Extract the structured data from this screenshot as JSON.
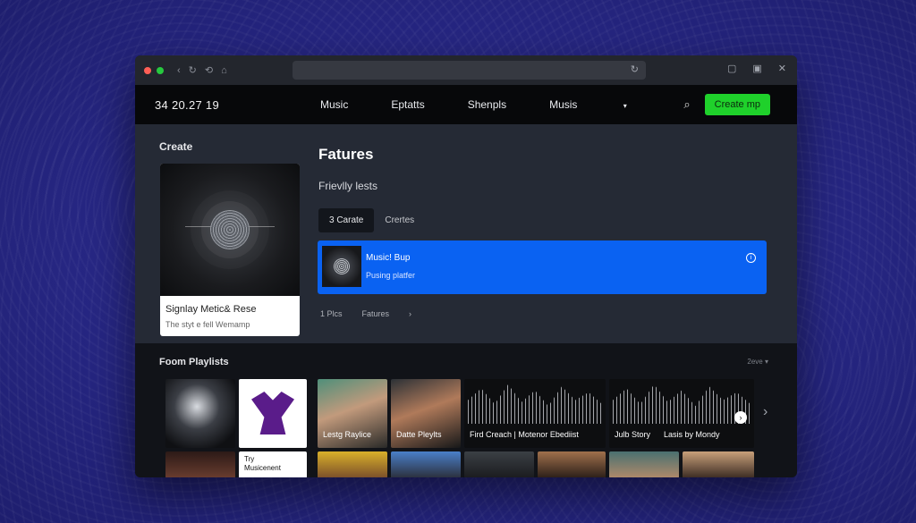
{
  "browser": {
    "icons": [
      "back-icon",
      "forward-icon",
      "history-icon",
      "share-icon",
      "reload-icon",
      "tabs-icon",
      "bookmark-icon",
      "close-icon"
    ]
  },
  "nav": {
    "brand": "34 20.27 19",
    "links": [
      "Music",
      "Eptatts",
      "Shenpls",
      "Musis"
    ],
    "create_button": "Create mp",
    "accent": "#1fd12b"
  },
  "main": {
    "create_label": "Create",
    "card": {
      "title": "Signlay Metic& Rese",
      "subtitle": "The styt e fell Wemamp"
    },
    "features_title": "Fatures",
    "features_subtitle": "Frievlly lests",
    "tabs": [
      "3 Carate",
      "Crertes"
    ],
    "player": {
      "title": "Music! Bup",
      "subtitle": "Pusing platfer",
      "accent": "#0a62f2"
    },
    "meta": [
      "1 Plcs",
      "Fatures",
      "›"
    ]
  },
  "playlists": {
    "title": "Foom Playlists",
    "sort": "2eve ▾",
    "tiles": [
      {
        "label": ""
      },
      {
        "label": ""
      },
      {
        "label": "Lestg Raylice"
      },
      {
        "label": "Datte Pleylts"
      },
      {
        "label": "Fird Creach | Motenor Ebediist"
      },
      {
        "label": "Julb Story      Lasis by Mondy"
      }
    ],
    "strip_label": "Try\nMusicenent"
  }
}
